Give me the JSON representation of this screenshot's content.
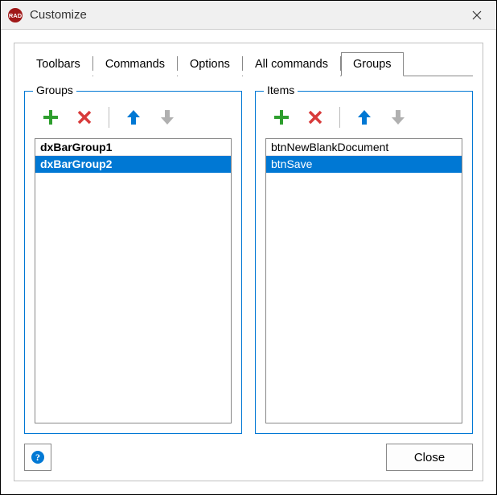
{
  "window": {
    "title": "Customize"
  },
  "tabs": {
    "items": [
      {
        "label": "Toolbars"
      },
      {
        "label": "Commands"
      },
      {
        "label": "Options"
      },
      {
        "label": "All commands"
      },
      {
        "label": "Groups"
      }
    ],
    "activeIndex": 4
  },
  "panels": {
    "groups": {
      "legend": "Groups",
      "items": [
        {
          "label": "dxBarGroup1",
          "bold": true,
          "selected": false
        },
        {
          "label": "dxBarGroup2",
          "bold": true,
          "selected": true
        }
      ]
    },
    "listItems": {
      "legend": "Items",
      "items": [
        {
          "label": "btnNewBlankDocument",
          "bold": false,
          "selected": false
        },
        {
          "label": "btnSave",
          "bold": false,
          "selected": true
        }
      ]
    }
  },
  "footer": {
    "close_label": "Close"
  },
  "colors": {
    "selection": "#0078d4",
    "add": "#2e9e2e",
    "remove": "#d83b3b",
    "up": "#0078d4",
    "down_disabled": "#b0b0b0"
  }
}
